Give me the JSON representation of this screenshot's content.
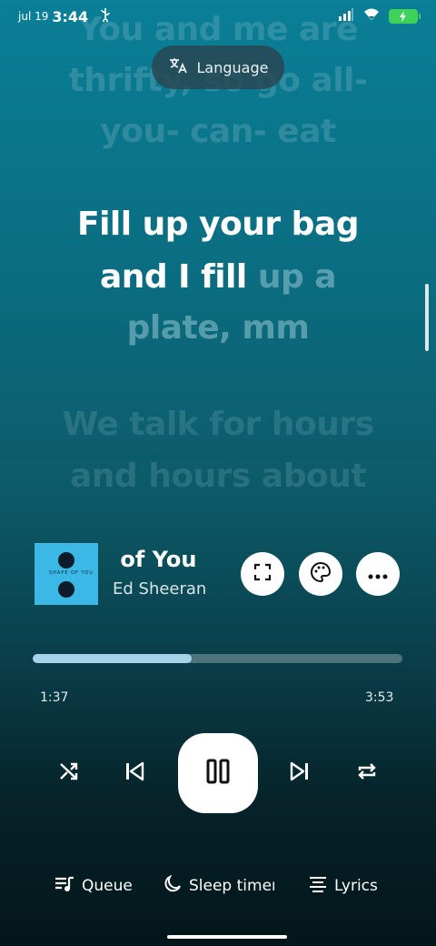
{
  "status_bar": {
    "date": "jul 19",
    "time": "3:44"
  },
  "lyrics": {
    "prev_lines": [
      "You and me are",
      "thrifty, so go all-",
      "you- can- eat"
    ],
    "current_sung_1": "Fill up your bag",
    "current_sung_2": "and I fill",
    "current_rest_2": " up a",
    "current_rest_3": "plate, mm",
    "next_lines": [
      "We talk for hours",
      "and hours about"
    ]
  },
  "language_button": {
    "label": "Language"
  },
  "now_playing": {
    "title": "Shape of You",
    "artist": "Ed Sheeran",
    "album_text": "SHAPE OF YOU"
  },
  "progress": {
    "elapsed": "1:37",
    "duration": "3:53",
    "fraction": 0.43
  },
  "bottom_bar": {
    "queue": "Queue",
    "sleep": "Sleep timer",
    "lyrics": "Lyrics"
  },
  "colors": {
    "accent": "#a6d3e9",
    "battery": "#3fd25a"
  },
  "icons": [
    "usb-icon",
    "signal-icon",
    "wifi-icon",
    "battery-icon",
    "translate-icon",
    "fullscreen-icon",
    "palette-icon",
    "more-icon",
    "shuffle-icon",
    "previous-icon",
    "pause-icon",
    "next-icon",
    "repeat-icon",
    "queue-icon",
    "moon-icon",
    "lyrics-icon"
  ]
}
